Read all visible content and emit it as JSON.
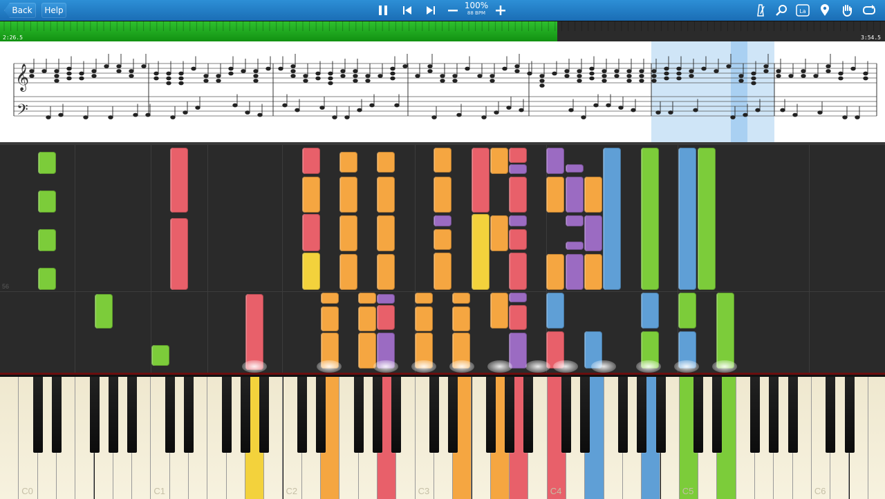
{
  "toolbar": {
    "back_label": "Back",
    "help_label": "Help",
    "zoom_percent": "100%",
    "tempo": "88 BPM",
    "icons": [
      "pause-icon",
      "rewind-icon",
      "skip-forward-icon",
      "minus-icon",
      "plus-icon",
      "metronome-icon",
      "search-icon",
      "note-labels-icon",
      "location-pin-icon",
      "hand-icon",
      "loop-icon"
    ],
    "note_label_glyph": "La"
  },
  "progress": {
    "elapsed": "2:26.5",
    "total": "3:54.5",
    "fraction": 0.63,
    "colors": {
      "played": "#1aa51a",
      "remaining": "#2b2b2b"
    }
  },
  "roll": {
    "measure_number": "56"
  },
  "keyboard": {
    "octave_labels": [
      "C0",
      "C1",
      "C2",
      "C3",
      "C4",
      "C5",
      "C6"
    ]
  },
  "colors": {
    "green": "#7ccc3a",
    "red": "#e8606a",
    "orange": "#f5a641",
    "yellow": "#f3d23c",
    "purple": "#9b6bc2",
    "blue": "#5f9fd6",
    "toolbar": "#1f78c3"
  }
}
